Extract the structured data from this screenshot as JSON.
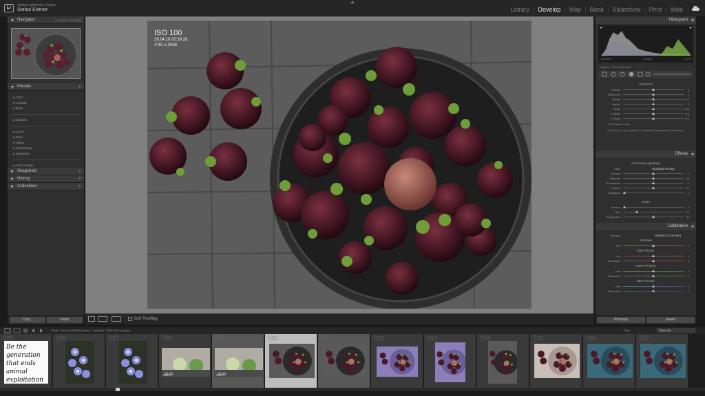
{
  "app": {
    "logo": "Lr",
    "name": "Adobe Lightroom Classic",
    "user": "Stefan Elstner"
  },
  "modules": [
    "Library",
    "Develop",
    "Map",
    "Book",
    "Slideshow",
    "Print",
    "Web"
  ],
  "active_module": "Develop",
  "left_panel": {
    "navigator": {
      "title": "Navigator",
      "zoom_options": "FIT  100%  200%  25%"
    },
    "presets": {
      "title": "Presets",
      "items": [
        "Color",
        "Creative",
        "B&W",
        "Defaults",
        "Curve",
        "Grain",
        "Optics",
        "Sharpening",
        "Vignetting",
        "User Presets"
      ]
    },
    "snapshots": "Snapshots",
    "history": "History",
    "collections": "Collections",
    "copy_label": "Copy...",
    "paste_label": "Paste"
  },
  "photo_info": {
    "iso": "ISO 100",
    "datetime": "26.04.16 00:39:28",
    "dimensions": "4781 x 3586"
  },
  "toolbar": {
    "soft_proofing": "Soft Proofing"
  },
  "right_panel": {
    "histogram": {
      "title": "Histogram",
      "info_left": "ISO 100",
      "info_mid": "35 mm",
      "info_right": "f / 2.8",
      "original": "Original + Smart Preview"
    },
    "transform": {
      "title": "Transform",
      "sliders": [
        {
          "label": "Vertical",
          "value": "0"
        },
        {
          "label": "Horizontal",
          "value": "0"
        },
        {
          "label": "Rotate",
          "value": "0.0"
        },
        {
          "label": "Aspect",
          "value": "0"
        },
        {
          "label": "Scale",
          "value": "100"
        },
        {
          "label": "X Offset",
          "value": "0.0"
        },
        {
          "label": "Y Offset",
          "value": "0.0"
        }
      ],
      "constrain": "Constrain Crop",
      "hint": "Draw two or more guides to customize perspective corrections."
    },
    "effects": {
      "title": "Effects",
      "vignette_title": "Post-Crop Vignetting",
      "style_label": "Style",
      "style_value": "Highlight Priority",
      "vignette_sliders": [
        {
          "label": "Amount",
          "value": "0"
        },
        {
          "label": "Midpoint",
          "value": "50"
        },
        {
          "label": "Roundness",
          "value": "0"
        },
        {
          "label": "Feather",
          "value": "50"
        },
        {
          "label": "Highlights",
          "value": "0"
        }
      ],
      "grain_title": "Grain",
      "grain_sliders": [
        {
          "label": "Amount",
          "value": "0"
        },
        {
          "label": "Size",
          "value": "25"
        },
        {
          "label": "Roughness",
          "value": "50"
        }
      ]
    },
    "calibration": {
      "title": "Calibration",
      "process_label": "Process",
      "process_value": "Version 5 (Current)",
      "shadows": "Shadows",
      "tint": {
        "label": "Tint",
        "value": "0"
      },
      "groups": [
        {
          "title": "Red Primary",
          "sliders": [
            {
              "label": "Hue",
              "value": "0"
            },
            {
              "label": "Saturation",
              "value": "0"
            }
          ]
        },
        {
          "title": "Green Primary",
          "sliders": [
            {
              "label": "Hue",
              "value": "0"
            },
            {
              "label": "Saturation",
              "value": "0"
            }
          ]
        },
        {
          "title": "Blue Primary",
          "sliders": [
            {
              "label": "Hue",
              "value": "0"
            },
            {
              "label": "Saturation",
              "value": "0"
            }
          ]
        }
      ]
    },
    "previous_label": "Previous",
    "reset_label": "Reset"
  },
  "filmstrip": {
    "source": "Folder : Sori Food     5895 photos / 1 selected / P5781442 copy.psd",
    "filter_label": "Filter :",
    "filter_value": "Filters Off",
    "cells": [
      {
        "num": "525",
        "kind": "text"
      },
      {
        "num": "526",
        "kind": "flower"
      },
      {
        "num": "527",
        "kind": "flower"
      },
      {
        "num": "528",
        "kind": "video",
        "duration": "00:12"
      },
      {
        "num": "529",
        "kind": "video",
        "duration": "00:15"
      },
      {
        "num": "530",
        "kind": "fruit",
        "selected": true
      },
      {
        "num": "531",
        "kind": "fruit"
      },
      {
        "num": "532",
        "kind": "fruit-lavender"
      },
      {
        "num": "533",
        "kind": "fruit-lavender"
      },
      {
        "num": "534",
        "kind": "fruit"
      },
      {
        "num": "535",
        "kind": "fruit-light"
      },
      {
        "num": "536",
        "kind": "fruit-teal"
      },
      {
        "num": "537",
        "kind": "fruit-teal"
      }
    ],
    "handwritten_text": "Be the generation that ends animal exploitation"
  }
}
